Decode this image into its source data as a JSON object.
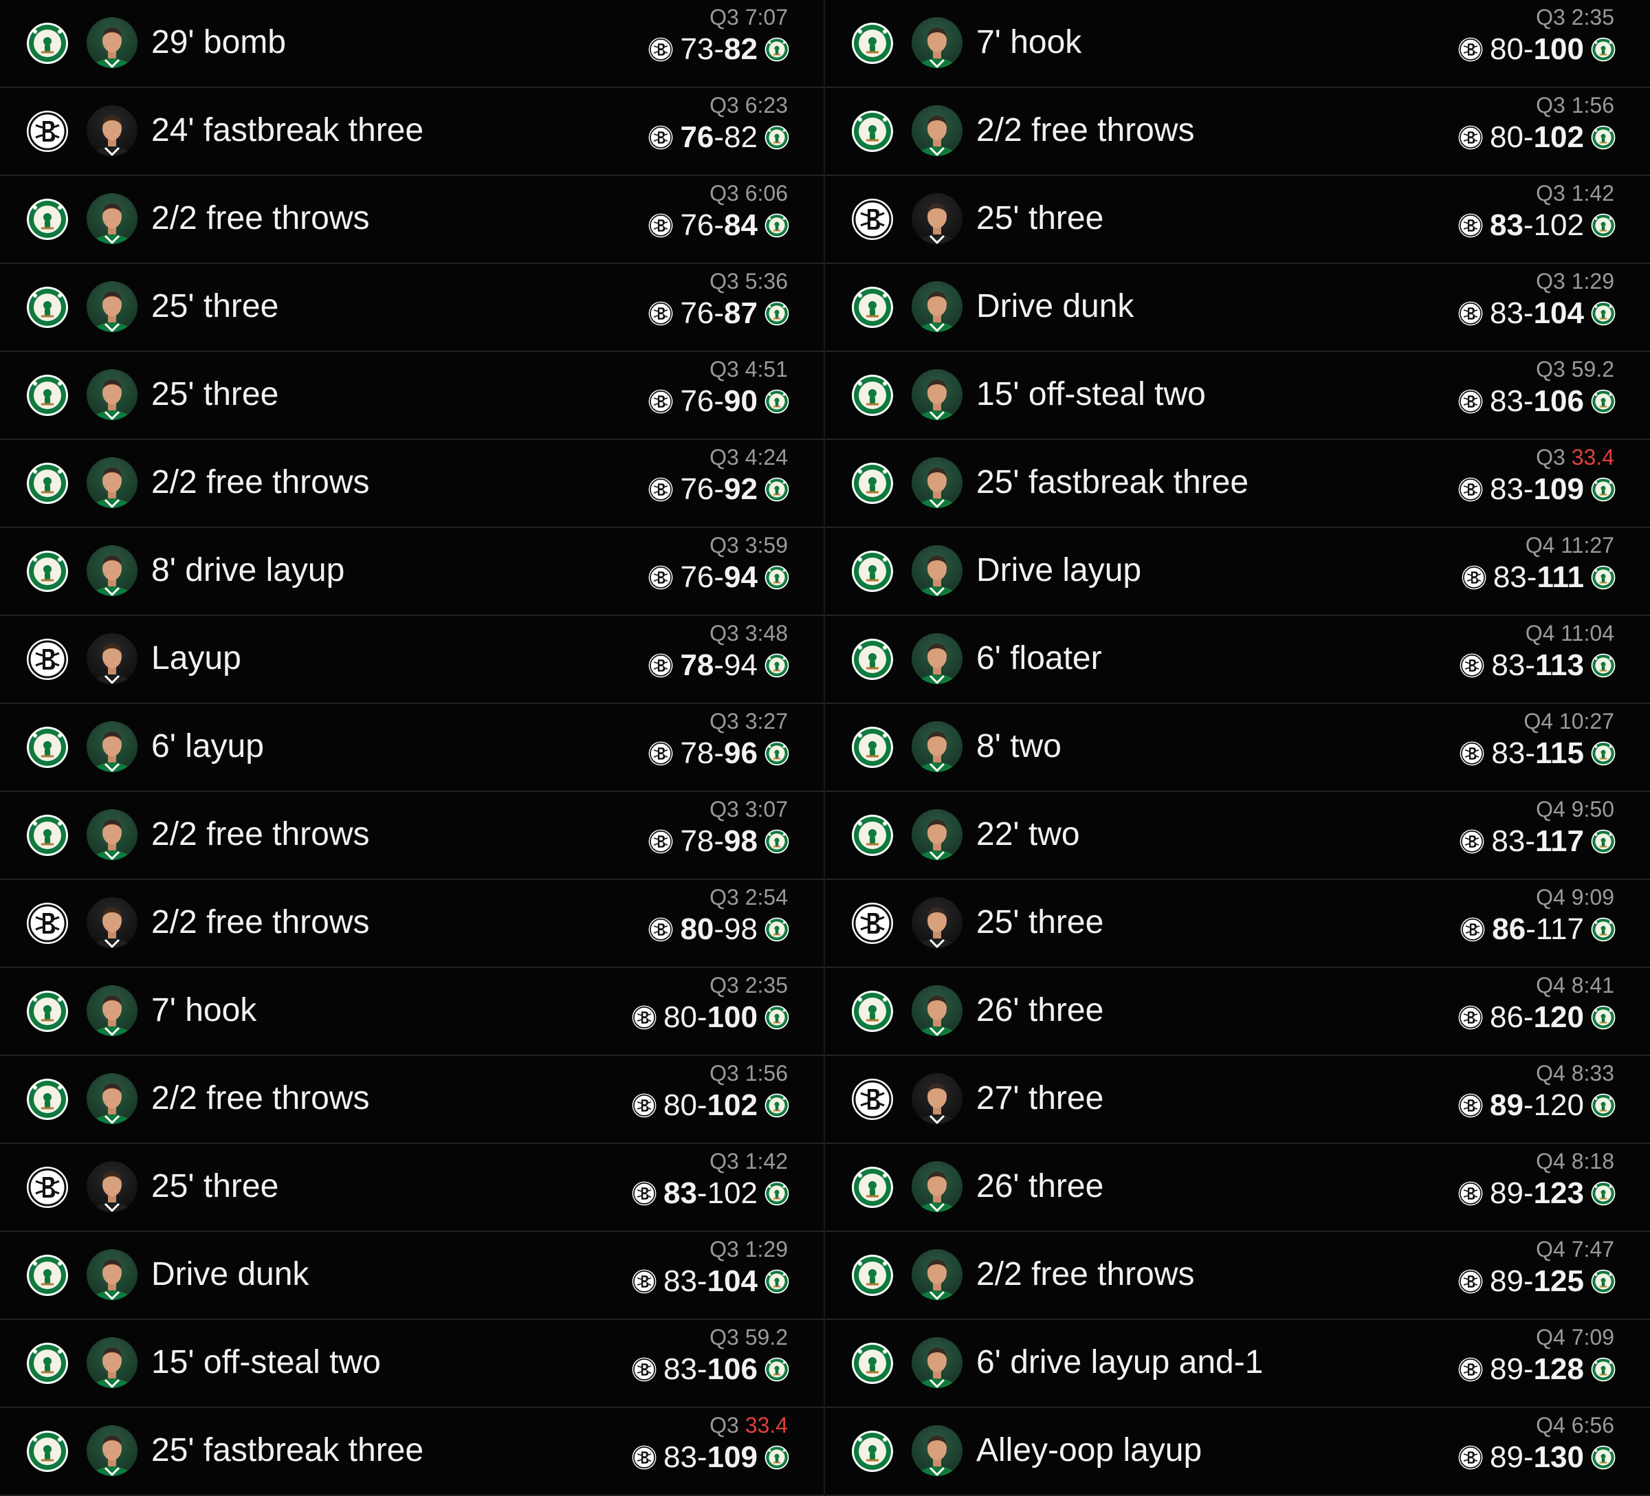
{
  "left_column": [
    {
      "team": "BOS",
      "player_team": "BOS",
      "text": "29' bomb",
      "quarter": "Q3",
      "clock": "7:07",
      "clock_red": false,
      "away": "73",
      "home": "82",
      "lead": "home"
    },
    {
      "team": "BKN",
      "player_team": "BKN",
      "text": "24' fastbreak three",
      "quarter": "Q3",
      "clock": "6:23",
      "clock_red": false,
      "away": "76",
      "home": "82",
      "lead": "away"
    },
    {
      "team": "BOS",
      "player_team": "BOS",
      "text": "2/2 free throws",
      "quarter": "Q3",
      "clock": "6:06",
      "clock_red": false,
      "away": "76",
      "home": "84",
      "lead": "home"
    },
    {
      "team": "BOS",
      "player_team": "BOS",
      "text": "25' three",
      "quarter": "Q3",
      "clock": "5:36",
      "clock_red": false,
      "away": "76",
      "home": "87",
      "lead": "home"
    },
    {
      "team": "BOS",
      "player_team": "BOS",
      "text": "25' three",
      "quarter": "Q3",
      "clock": "4:51",
      "clock_red": false,
      "away": "76",
      "home": "90",
      "lead": "home"
    },
    {
      "team": "BOS",
      "player_team": "BOS",
      "text": "2/2 free throws",
      "quarter": "Q3",
      "clock": "4:24",
      "clock_red": false,
      "away": "76",
      "home": "92",
      "lead": "home"
    },
    {
      "team": "BOS",
      "player_team": "BOS",
      "text": "8' drive layup",
      "quarter": "Q3",
      "clock": "3:59",
      "clock_red": false,
      "away": "76",
      "home": "94",
      "lead": "home"
    },
    {
      "team": "BKN",
      "player_team": "BKN",
      "text": "Layup",
      "quarter": "Q3",
      "clock": "3:48",
      "clock_red": false,
      "away": "78",
      "home": "94",
      "lead": "away"
    },
    {
      "team": "BOS",
      "player_team": "BOS",
      "text": "6' layup",
      "quarter": "Q3",
      "clock": "3:27",
      "clock_red": false,
      "away": "78",
      "home": "96",
      "lead": "home"
    },
    {
      "team": "BOS",
      "player_team": "BOS",
      "text": "2/2 free throws",
      "quarter": "Q3",
      "clock": "3:07",
      "clock_red": false,
      "away": "78",
      "home": "98",
      "lead": "home"
    },
    {
      "team": "BKN",
      "player_team": "BKN",
      "text": "2/2 free throws",
      "quarter": "Q3",
      "clock": "2:54",
      "clock_red": false,
      "away": "80",
      "home": "98",
      "lead": "away"
    },
    {
      "team": "BOS",
      "player_team": "BOS",
      "text": "7' hook",
      "quarter": "Q3",
      "clock": "2:35",
      "clock_red": false,
      "away": "80",
      "home": "100",
      "lead": "home"
    },
    {
      "team": "BOS",
      "player_team": "BOS",
      "text": "2/2 free throws",
      "quarter": "Q3",
      "clock": "1:56",
      "clock_red": false,
      "away": "80",
      "home": "102",
      "lead": "home"
    },
    {
      "team": "BKN",
      "player_team": "BKN",
      "text": "25' three",
      "quarter": "Q3",
      "clock": "1:42",
      "clock_red": false,
      "away": "83",
      "home": "102",
      "lead": "away"
    },
    {
      "team": "BOS",
      "player_team": "BOS",
      "text": "Drive dunk",
      "quarter": "Q3",
      "clock": "1:29",
      "clock_red": false,
      "away": "83",
      "home": "104",
      "lead": "home"
    },
    {
      "team": "BOS",
      "player_team": "BOS",
      "text": "15' off-steal two",
      "quarter": "Q3",
      "clock": "59.2",
      "clock_red": false,
      "away": "83",
      "home": "106",
      "lead": "home"
    },
    {
      "team": "BOS",
      "player_team": "BOS",
      "text": "25' fastbreak three",
      "quarter": "Q3",
      "clock": "33.4",
      "clock_red": true,
      "away": "83",
      "home": "109",
      "lead": "home"
    }
  ],
  "right_column": [
    {
      "team": "BOS",
      "player_team": "BOS",
      "text": "7' hook",
      "quarter": "Q3",
      "clock": "2:35",
      "clock_red": false,
      "away": "80",
      "home": "100",
      "lead": "home"
    },
    {
      "team": "BOS",
      "player_team": "BOS",
      "text": "2/2 free throws",
      "quarter": "Q3",
      "clock": "1:56",
      "clock_red": false,
      "away": "80",
      "home": "102",
      "lead": "home"
    },
    {
      "team": "BKN",
      "player_team": "BKN",
      "text": "25' three",
      "quarter": "Q3",
      "clock": "1:42",
      "clock_red": false,
      "away": "83",
      "home": "102",
      "lead": "away"
    },
    {
      "team": "BOS",
      "player_team": "BOS",
      "text": "Drive dunk",
      "quarter": "Q3",
      "clock": "1:29",
      "clock_red": false,
      "away": "83",
      "home": "104",
      "lead": "home"
    },
    {
      "team": "BOS",
      "player_team": "BOS",
      "text": "15' off-steal two",
      "quarter": "Q3",
      "clock": "59.2",
      "clock_red": false,
      "away": "83",
      "home": "106",
      "lead": "home"
    },
    {
      "team": "BOS",
      "player_team": "BOS",
      "text": "25' fastbreak three",
      "quarter": "Q3",
      "clock": "33.4",
      "clock_red": true,
      "away": "83",
      "home": "109",
      "lead": "home"
    },
    {
      "team": "BOS",
      "player_team": "BOS",
      "text": "Drive layup",
      "quarter": "Q4",
      "clock": "11:27",
      "clock_red": false,
      "away": "83",
      "home": "111",
      "lead": "home"
    },
    {
      "team": "BOS",
      "player_team": "BOS",
      "text": "6' floater",
      "quarter": "Q4",
      "clock": "11:04",
      "clock_red": false,
      "away": "83",
      "home": "113",
      "lead": "home"
    },
    {
      "team": "BOS",
      "player_team": "BOS",
      "text": "8' two",
      "quarter": "Q4",
      "clock": "10:27",
      "clock_red": false,
      "away": "83",
      "home": "115",
      "lead": "home"
    },
    {
      "team": "BOS",
      "player_team": "BOS",
      "text": "22' two",
      "quarter": "Q4",
      "clock": "9:50",
      "clock_red": false,
      "away": "83",
      "home": "117",
      "lead": "home"
    },
    {
      "team": "BKN",
      "player_team": "BKN",
      "text": "25' three",
      "quarter": "Q4",
      "clock": "9:09",
      "clock_red": false,
      "away": "86",
      "home": "117",
      "lead": "away"
    },
    {
      "team": "BOS",
      "player_team": "BOS",
      "text": "26' three",
      "quarter": "Q4",
      "clock": "8:41",
      "clock_red": false,
      "away": "86",
      "home": "120",
      "lead": "home"
    },
    {
      "team": "BKN",
      "player_team": "BKN",
      "text": "27' three",
      "quarter": "Q4",
      "clock": "8:33",
      "clock_red": false,
      "away": "89",
      "home": "120",
      "lead": "away"
    },
    {
      "team": "BOS",
      "player_team": "BOS",
      "text": "26' three",
      "quarter": "Q4",
      "clock": "8:18",
      "clock_red": false,
      "away": "89",
      "home": "123",
      "lead": "home"
    },
    {
      "team": "BOS",
      "player_team": "BOS",
      "text": "2/2 free throws",
      "quarter": "Q4",
      "clock": "7:47",
      "clock_red": false,
      "away": "89",
      "home": "125",
      "lead": "home"
    },
    {
      "team": "BOS",
      "player_team": "BOS",
      "text": "6' drive layup and-1",
      "quarter": "Q4",
      "clock": "7:09",
      "clock_red": false,
      "away": "89",
      "home": "128",
      "lead": "home"
    },
    {
      "team": "BOS",
      "player_team": "BOS",
      "text": "Alley-oop layup",
      "quarter": "Q4",
      "clock": "6:56",
      "clock_red": false,
      "away": "89",
      "home": "130",
      "lead": "home"
    }
  ],
  "icons": {
    "away_team_logo": "nets-logo-icon",
    "home_team_logo": "celtics-logo-icon",
    "player_avatar": "player-headshot-icon"
  },
  "colors": {
    "background": "#000000",
    "row_background": "#050505",
    "row_divider": "#222222",
    "text": "#f2f2f2",
    "muted_text": "#9a9a9a",
    "clock_highlight": "#e0403a",
    "celtics_green": "#0e7a3d",
    "nets_black": "#111111"
  }
}
